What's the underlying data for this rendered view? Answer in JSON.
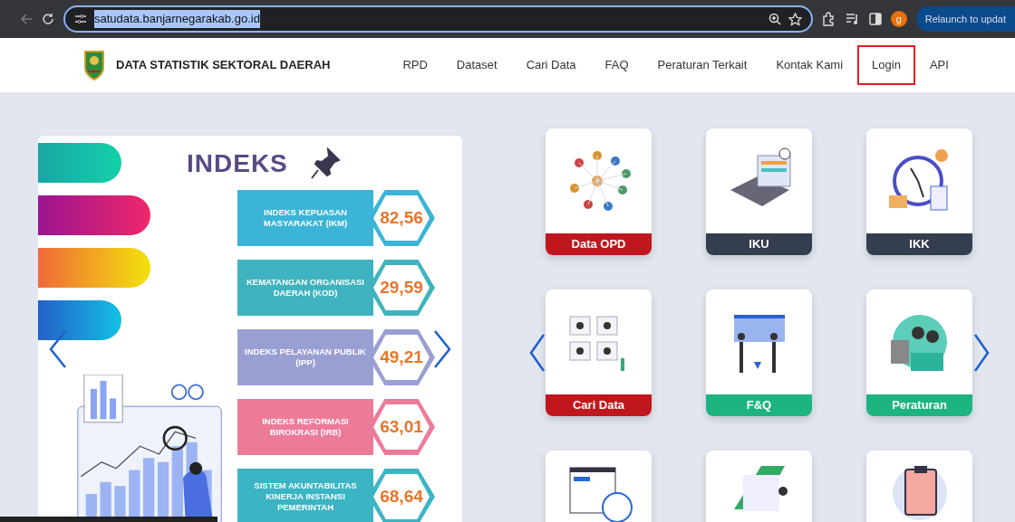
{
  "browser": {
    "url": "satudata.banjarnegarakab.go.id",
    "url_selected": true,
    "profile_initial": "g",
    "relaunch_label": "Relaunch to updat"
  },
  "navbar": {
    "brand": "DATA STATISTIK SEKTORAL DAERAH",
    "links": [
      {
        "label": "RPD",
        "highlighted": false
      },
      {
        "label": "Dataset",
        "highlighted": false
      },
      {
        "label": "Cari Data",
        "highlighted": false
      },
      {
        "label": "FAQ",
        "highlighted": false
      },
      {
        "label": "Peraturan Terkait",
        "highlighted": false
      },
      {
        "label": "Kontak Kami",
        "highlighted": false
      },
      {
        "label": "Login",
        "highlighted": true
      },
      {
        "label": "API",
        "highlighted": false
      }
    ]
  },
  "banner": {
    "title": "INDEKS",
    "indices": [
      {
        "label": "INDEKS KEPUASAN MASYARAKAT (IKM)",
        "value": "82,56",
        "color": "#3bb4d8"
      },
      {
        "label": "KEMATANGAN ORGANISASI DAERAH (KOD)",
        "value": "29,59",
        "color": "#3fb3bf"
      },
      {
        "label": "INDEKS PELAYANAN PUBLIK (IPP)",
        "value": "49,21",
        "color": "#9a9fd3"
      },
      {
        "label": "INDEKS REFORMASI BIROKRASI (IRB)",
        "value": "63,01",
        "color": "#ec7b9a"
      },
      {
        "label": "SISTEM AKUNTABILITAS KINERJA INSTANSI PEMERINTAH",
        "value": "68,64",
        "color": "#3bb4c4"
      }
    ]
  },
  "tiles": [
    {
      "kind": "labelled",
      "label": "Data OPD",
      "color": "#c0171e"
    },
    {
      "kind": "labelled",
      "label": "IKU",
      "color": "#343e4f"
    },
    {
      "kind": "labelled",
      "label": "IKK",
      "color": "#343e4f"
    },
    {
      "kind": "labelled",
      "label": "Cari Data",
      "color": "#c0171e"
    },
    {
      "kind": "labelled",
      "label": "F&Q",
      "color": "#1eb47f"
    },
    {
      "kind": "labelled",
      "label": "Peraturan",
      "color": "#1eb47f"
    },
    {
      "kind": "cropped"
    },
    {
      "kind": "cropped"
    },
    {
      "kind": "cropped"
    }
  ]
}
